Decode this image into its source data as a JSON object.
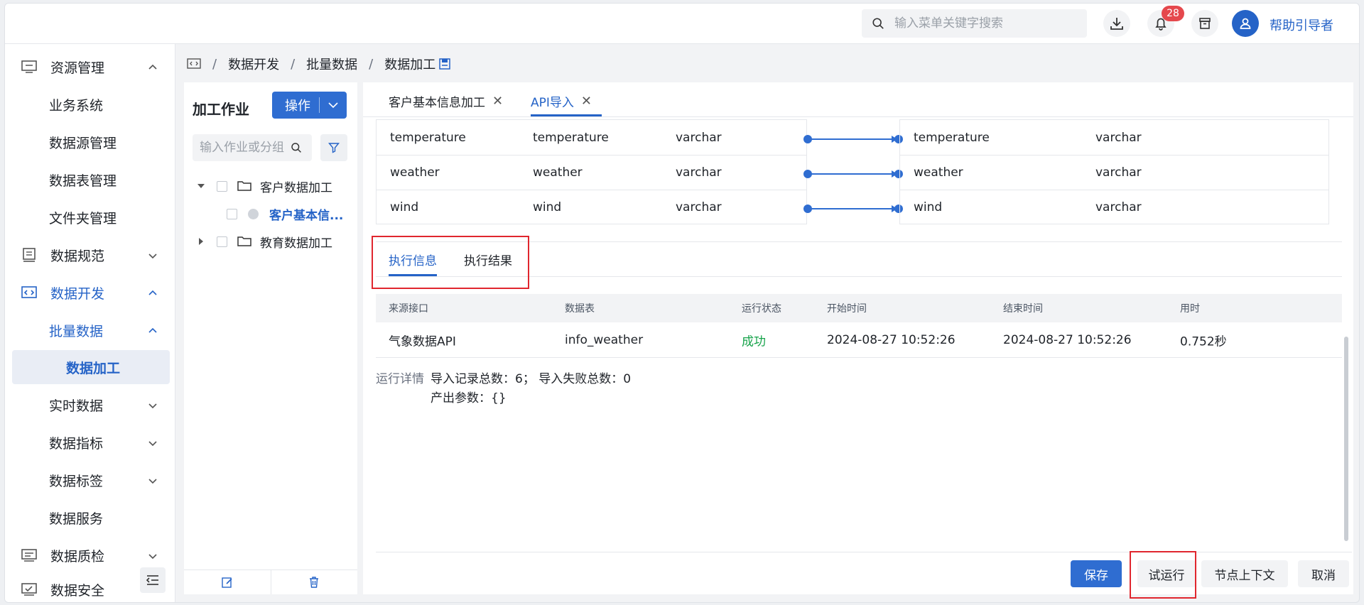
{
  "header": {
    "search_placeholder": "输入菜单关键字搜索",
    "notification_count": "28",
    "user_name": "帮助引导者"
  },
  "sidebar": {
    "items": [
      {
        "label": "资源管理"
      },
      {
        "label": "业务系统"
      },
      {
        "label": "数据源管理"
      },
      {
        "label": "数据表管理"
      },
      {
        "label": "文件夹管理"
      },
      {
        "label": "数据规范"
      },
      {
        "label": "数据开发"
      },
      {
        "label": "批量数据"
      },
      {
        "label": "数据加工"
      },
      {
        "label": "实时数据"
      },
      {
        "label": "数据指标"
      },
      {
        "label": "数据标签"
      },
      {
        "label": "数据服务"
      },
      {
        "label": "数据质检"
      },
      {
        "label": "数据安全"
      }
    ]
  },
  "breadcrumb": {
    "sep": "/",
    "items": [
      "数据开发",
      "批量数据",
      "数据加工"
    ]
  },
  "job_panel": {
    "title": "加工作业",
    "op_button": "操作",
    "search_placeholder": "输入作业或分组",
    "tree": [
      {
        "label": "客户数据加工"
      },
      {
        "label": "客户基本信..."
      },
      {
        "label": "教育数据加工"
      }
    ]
  },
  "tabs": [
    {
      "label": "客户基本信息加工",
      "close": "✕"
    },
    {
      "label": "API导入",
      "close": "✕"
    }
  ],
  "mapping": {
    "rows": [
      {
        "src_name": "temperature",
        "src_field": "temperature",
        "src_type": "varchar",
        "tgt_name": "temperature",
        "tgt_type": "varchar"
      },
      {
        "src_name": "weather",
        "src_field": "weather",
        "src_type": "varchar",
        "tgt_name": "weather",
        "tgt_type": "varchar"
      },
      {
        "src_name": "wind",
        "src_field": "wind",
        "src_type": "varchar",
        "tgt_name": "wind",
        "tgt_type": "varchar"
      }
    ]
  },
  "exec_tabs": {
    "info": "执行信息",
    "result": "执行结果"
  },
  "result_table": {
    "columns": [
      "来源接口",
      "数据表",
      "运行状态",
      "开始时间",
      "结束时间",
      "用时"
    ],
    "row": {
      "source": "气象数据API",
      "table": "info_weather",
      "status": "成功",
      "start": "2024-08-27 10:52:26",
      "end": "2024-08-27 10:52:26",
      "duration": "0.752秒"
    }
  },
  "details": {
    "label": "运行详情",
    "line1": "导入记录总数：6；  导入失败总数：0",
    "line2": "产出参数：{}"
  },
  "footer_buttons": {
    "save": "保存",
    "trial_run": "试运行",
    "node_context": "节点上下文",
    "cancel": "取消"
  },
  "colors": {
    "accent": "#2563c7",
    "success": "#16a34a",
    "highlight": "#e0262e",
    "badge": "#e5484d"
  }
}
